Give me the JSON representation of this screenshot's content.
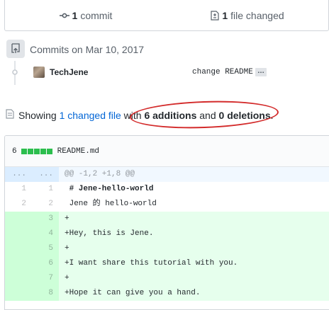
{
  "stats": {
    "commits_count": "1",
    "commits_label": "commit",
    "files_count": "1",
    "files_label": "file changed"
  },
  "commits": {
    "date_label": "Commits on Mar 10, 2017",
    "items": [
      {
        "author": "TechJene",
        "message": "change README",
        "more": "…"
      }
    ]
  },
  "summary": {
    "prefix": "Showing",
    "changed_link": "1 changed file",
    "with": "with",
    "additions": "6 additions",
    "and": "and",
    "deletions": "0 deletions",
    "period": "."
  },
  "file": {
    "change_count": "6",
    "name": "README.md",
    "diffstat_blocks": 5,
    "hunk": {
      "old": "...",
      "new": "...",
      "text": "@@ -1,2 +1,8 @@"
    },
    "lines": [
      {
        "old": "1",
        "new": "1",
        "text": " # Jene-hello-world",
        "type": "ctx"
      },
      {
        "old": "2",
        "new": "2",
        "text": " Jene 的 hello-world",
        "type": "ctx"
      },
      {
        "old": "",
        "new": "3",
        "text": "+",
        "type": "add"
      },
      {
        "old": "",
        "new": "4",
        "text": "+Hey, this is Jene.",
        "type": "add"
      },
      {
        "old": "",
        "new": "5",
        "text": "+",
        "type": "add"
      },
      {
        "old": "",
        "new": "6",
        "text": "+I want share this tutorial with you.",
        "type": "add"
      },
      {
        "old": "",
        "new": "7",
        "text": "+",
        "type": "add"
      },
      {
        "old": "",
        "new": "8",
        "text": "+Hope it can give you a hand.",
        "type": "add"
      }
    ]
  },
  "colors": {
    "link": "#0366d6",
    "addition_green": "#2cbe4e",
    "annotation_red": "#d32a2a"
  },
  "icons": [
    "commit-icon",
    "file-diff-icon",
    "repo-push-icon",
    "commit-dot-icon",
    "toc-icon"
  ]
}
